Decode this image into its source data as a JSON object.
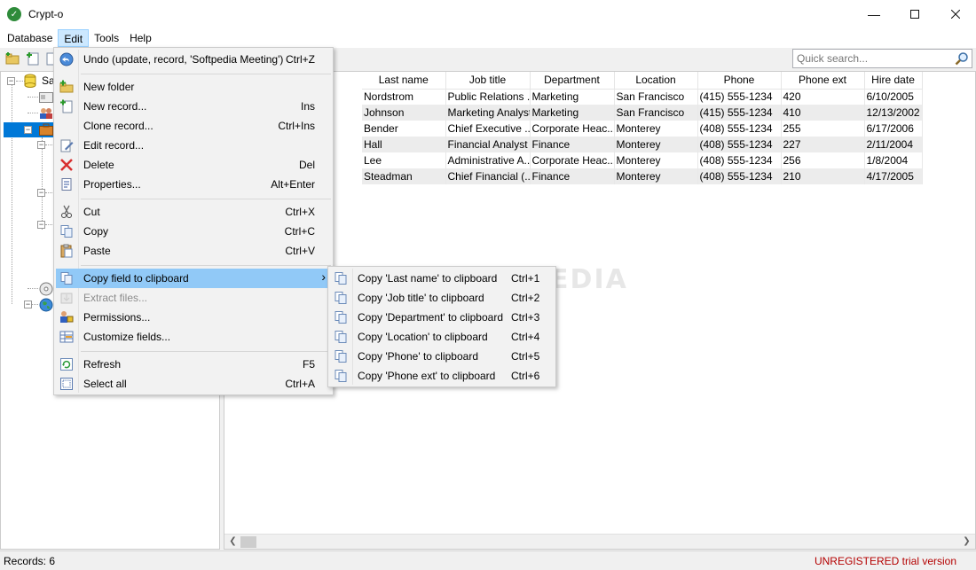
{
  "window": {
    "title": "Crypt-o"
  },
  "menubar": [
    "Database",
    "Edit",
    "Tools",
    "Help"
  ],
  "search": {
    "placeholder": "Quick search..."
  },
  "tree": {
    "root_label": "Sa"
  },
  "grid": {
    "columns": [
      "Last name",
      "Job title",
      "Department",
      "Location",
      "Phone",
      "Phone ext",
      "Hire date"
    ],
    "rows": [
      [
        "Nordstrom",
        "Public Relations ...",
        "Marketing",
        "San Francisco",
        "(415) 555-1234",
        "420",
        "6/10/2005"
      ],
      [
        "Johnson",
        "Marketing Analyst",
        "Marketing",
        "San Francisco",
        "(415) 555-1234",
        "410",
        "12/13/2002"
      ],
      [
        "Bender",
        "Chief Executive ...",
        "Corporate Heac...",
        "Monterey",
        "(408) 555-1234",
        "255",
        "6/17/2006"
      ],
      [
        "Hall",
        "Financial Analyst",
        "Finance",
        "Monterey",
        "(408) 555-1234",
        "227",
        "2/11/2004"
      ],
      [
        "Lee",
        "Administrative A...",
        "Corporate Heac...",
        "Monterey",
        "(408) 555-1234",
        "256",
        "1/8/2004"
      ],
      [
        "Steadman",
        "Chief Financial (...",
        "Finance",
        "Monterey",
        "(408) 555-1234",
        "210",
        "4/17/2005"
      ]
    ]
  },
  "edit_menu": {
    "items": [
      {
        "label": "Undo (update, record, 'Softpedia Meeting')",
        "shortcut": "Ctrl+Z",
        "icon": "undo-icon"
      },
      {
        "label": "New folder",
        "shortcut": "",
        "icon": "new-folder-icon"
      },
      {
        "label": "New record...",
        "shortcut": "Ins",
        "icon": "new-record-icon"
      },
      {
        "label": "Clone record...",
        "shortcut": "Ctrl+Ins",
        "icon": ""
      },
      {
        "label": "Edit record...",
        "shortcut": "",
        "icon": "edit-icon"
      },
      {
        "label": "Delete",
        "shortcut": "Del",
        "icon": "delete-icon"
      },
      {
        "label": "Properties...",
        "shortcut": "Alt+Enter",
        "icon": "properties-icon"
      },
      {
        "label": "Cut",
        "shortcut": "Ctrl+X",
        "icon": "cut-icon"
      },
      {
        "label": "Copy",
        "shortcut": "Ctrl+C",
        "icon": "copy-icon"
      },
      {
        "label": "Paste",
        "shortcut": "Ctrl+V",
        "icon": "paste-icon"
      },
      {
        "label": "Copy field to clipboard",
        "shortcut": "",
        "icon": "copy-field-icon"
      },
      {
        "label": "Extract files...",
        "shortcut": "",
        "icon": "extract-icon"
      },
      {
        "label": "Permissions...",
        "shortcut": "",
        "icon": "permissions-icon"
      },
      {
        "label": "Customize fields...",
        "shortcut": "",
        "icon": "customize-icon"
      },
      {
        "label": "Refresh",
        "shortcut": "F5",
        "icon": "refresh-icon"
      },
      {
        "label": "Select all",
        "shortcut": "Ctrl+A",
        "icon": "select-all-icon"
      }
    ]
  },
  "submenu": {
    "items": [
      {
        "label": "Copy 'Last name' to clipboard",
        "shortcut": "Ctrl+1"
      },
      {
        "label": "Copy 'Job title' to clipboard",
        "shortcut": "Ctrl+2"
      },
      {
        "label": "Copy 'Department' to clipboard",
        "shortcut": "Ctrl+3"
      },
      {
        "label": "Copy 'Location' to clipboard",
        "shortcut": "Ctrl+4"
      },
      {
        "label": "Copy 'Phone' to clipboard",
        "shortcut": "Ctrl+5"
      },
      {
        "label": "Copy 'Phone ext' to clipboard",
        "shortcut": "Ctrl+6"
      }
    ]
  },
  "watermark": "SOFTPEDIA",
  "status": {
    "records": "Records: 6",
    "trial": "UNREGISTERED trial version"
  },
  "colors": {
    "highlight": "#91c9f7",
    "trial_text": "#b40000",
    "menu_active": "#cce8ff"
  }
}
